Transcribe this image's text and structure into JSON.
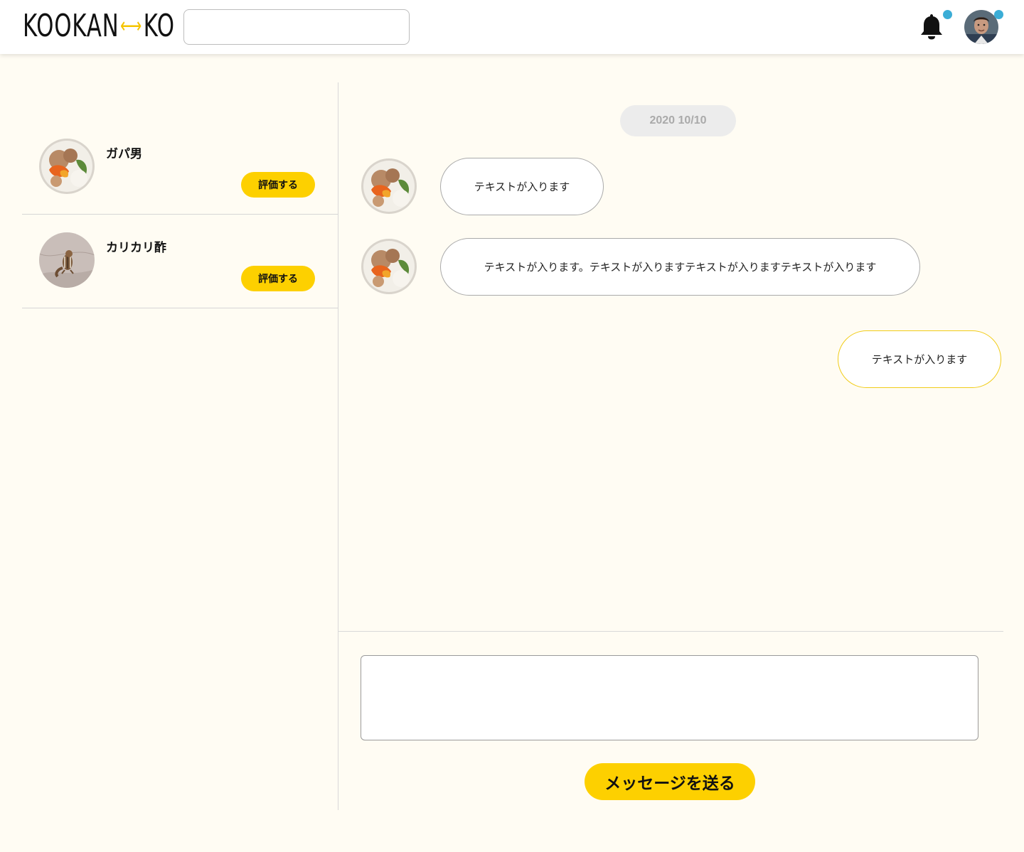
{
  "header": {
    "logo_left": "KOOKAN",
    "logo_mark": "⟷",
    "logo_right": "KO",
    "search_value": "",
    "search_placeholder": "",
    "notification_icon": "bell-icon",
    "notification_badge": true,
    "profile_badge": true
  },
  "contacts": [
    {
      "name": "ガパ男",
      "rate_label": "評価する",
      "thumb": "food-bowl"
    },
    {
      "name": "カリカリ酢",
      "rate_label": "評価する",
      "thumb": "chipmunk"
    }
  ],
  "chat": {
    "date": "2020 10/10",
    "messages": [
      {
        "from": "other",
        "text": "テキストが入ります"
      },
      {
        "from": "other",
        "text": "テキストが入ります。テキストが入りますテキストが入りますテキストが入ります"
      },
      {
        "from": "me",
        "text": "テキストが入ります"
      }
    ]
  },
  "composer": {
    "value": "",
    "placeholder": "",
    "send_label": "メッセージを送る"
  },
  "colors": {
    "background": "#fffcf3",
    "accent": "#fdd000",
    "badge": "#3badd6",
    "mine_bubble_border": "#f1cc18"
  }
}
